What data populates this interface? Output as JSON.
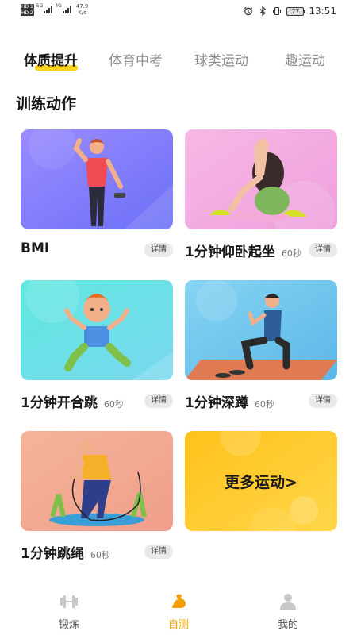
{
  "status_bar": {
    "sim1": "HD 1",
    "sim2": "HD 2",
    "net1": "5G",
    "net2": "4G",
    "speed_value": "47.9",
    "speed_unit": "K/s",
    "battery": "77",
    "time": "13:51",
    "icons": [
      "alarm-icon",
      "bluetooth-icon",
      "vibrate-icon"
    ]
  },
  "tabs": [
    {
      "label": "体质提升",
      "active": true
    },
    {
      "label": "体育中考",
      "active": false
    },
    {
      "label": "球类运动",
      "active": false
    },
    {
      "label": "趣运动",
      "active": false
    }
  ],
  "section_title": "训练动作",
  "cards": [
    {
      "title": "BMI",
      "duration": "",
      "detail": "详情"
    },
    {
      "title": "1分钟仰卧起坐",
      "duration": "60秒",
      "detail": "详情"
    },
    {
      "title": "1分钟开合跳",
      "duration": "60秒",
      "detail": "详情"
    },
    {
      "title": "1分钟深蹲",
      "duration": "60秒",
      "detail": "详情"
    },
    {
      "title": "1分钟跳绳",
      "duration": "60秒",
      "detail": "详情"
    }
  ],
  "more_card": {
    "label": "更多运动>"
  },
  "bottom_nav": [
    {
      "label": "锻炼",
      "icon": "dumbbell-icon",
      "active": false
    },
    {
      "label": "自测",
      "icon": "flexed-arm-icon",
      "active": true
    },
    {
      "label": "我的",
      "icon": "person-icon",
      "active": false
    }
  ],
  "colors": {
    "accent": "#ffd21f",
    "nav_active": "#f5a000"
  }
}
